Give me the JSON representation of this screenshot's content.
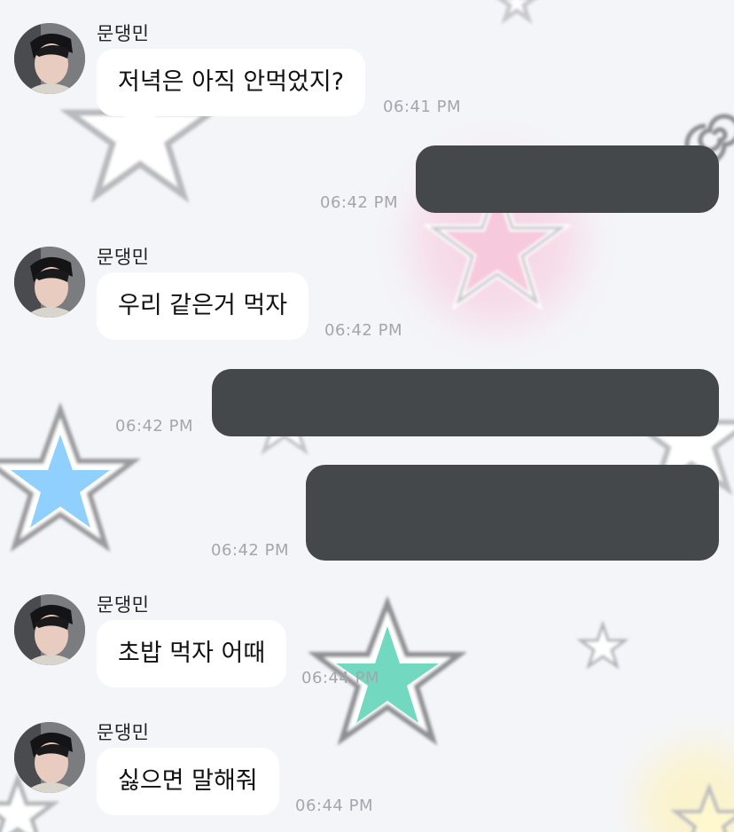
{
  "messages": [
    {
      "direction": "in",
      "sender": "문댕민",
      "text": "저녁은 아직 안먹었지?",
      "time": "06:41 PM"
    },
    {
      "direction": "out",
      "text": "",
      "time": "06:42 PM",
      "redacted": true
    },
    {
      "direction": "in",
      "sender": "문댕민",
      "text": "우리 같은거 먹자",
      "time": "06:42 PM"
    },
    {
      "direction": "out",
      "text": "",
      "time": "06:42 PM",
      "redacted": true
    },
    {
      "direction": "out",
      "text": "",
      "time": "06:42 PM",
      "redacted": true
    },
    {
      "direction": "in",
      "sender": "문댕민",
      "text": "초밥 먹자 어때",
      "time": "06:44 PM"
    },
    {
      "direction": "in",
      "sender": "문댕민",
      "text": "싫으면 말해줘",
      "time": "06:44 PM"
    }
  ],
  "colors": {
    "background": "#f4f5f9",
    "incoming_bubble": "#ffffff",
    "outgoing_bubble": "#45484b",
    "timestamp": "#a3a6ab",
    "star_pink": "#f7c9dc",
    "star_blue": "#8fd0ff",
    "star_teal": "#72d9c0"
  },
  "wallpaper": {
    "stickers": [
      "star-outline",
      "pink-star",
      "blue-star",
      "teal-star",
      "swirl",
      "yellow-star"
    ]
  }
}
